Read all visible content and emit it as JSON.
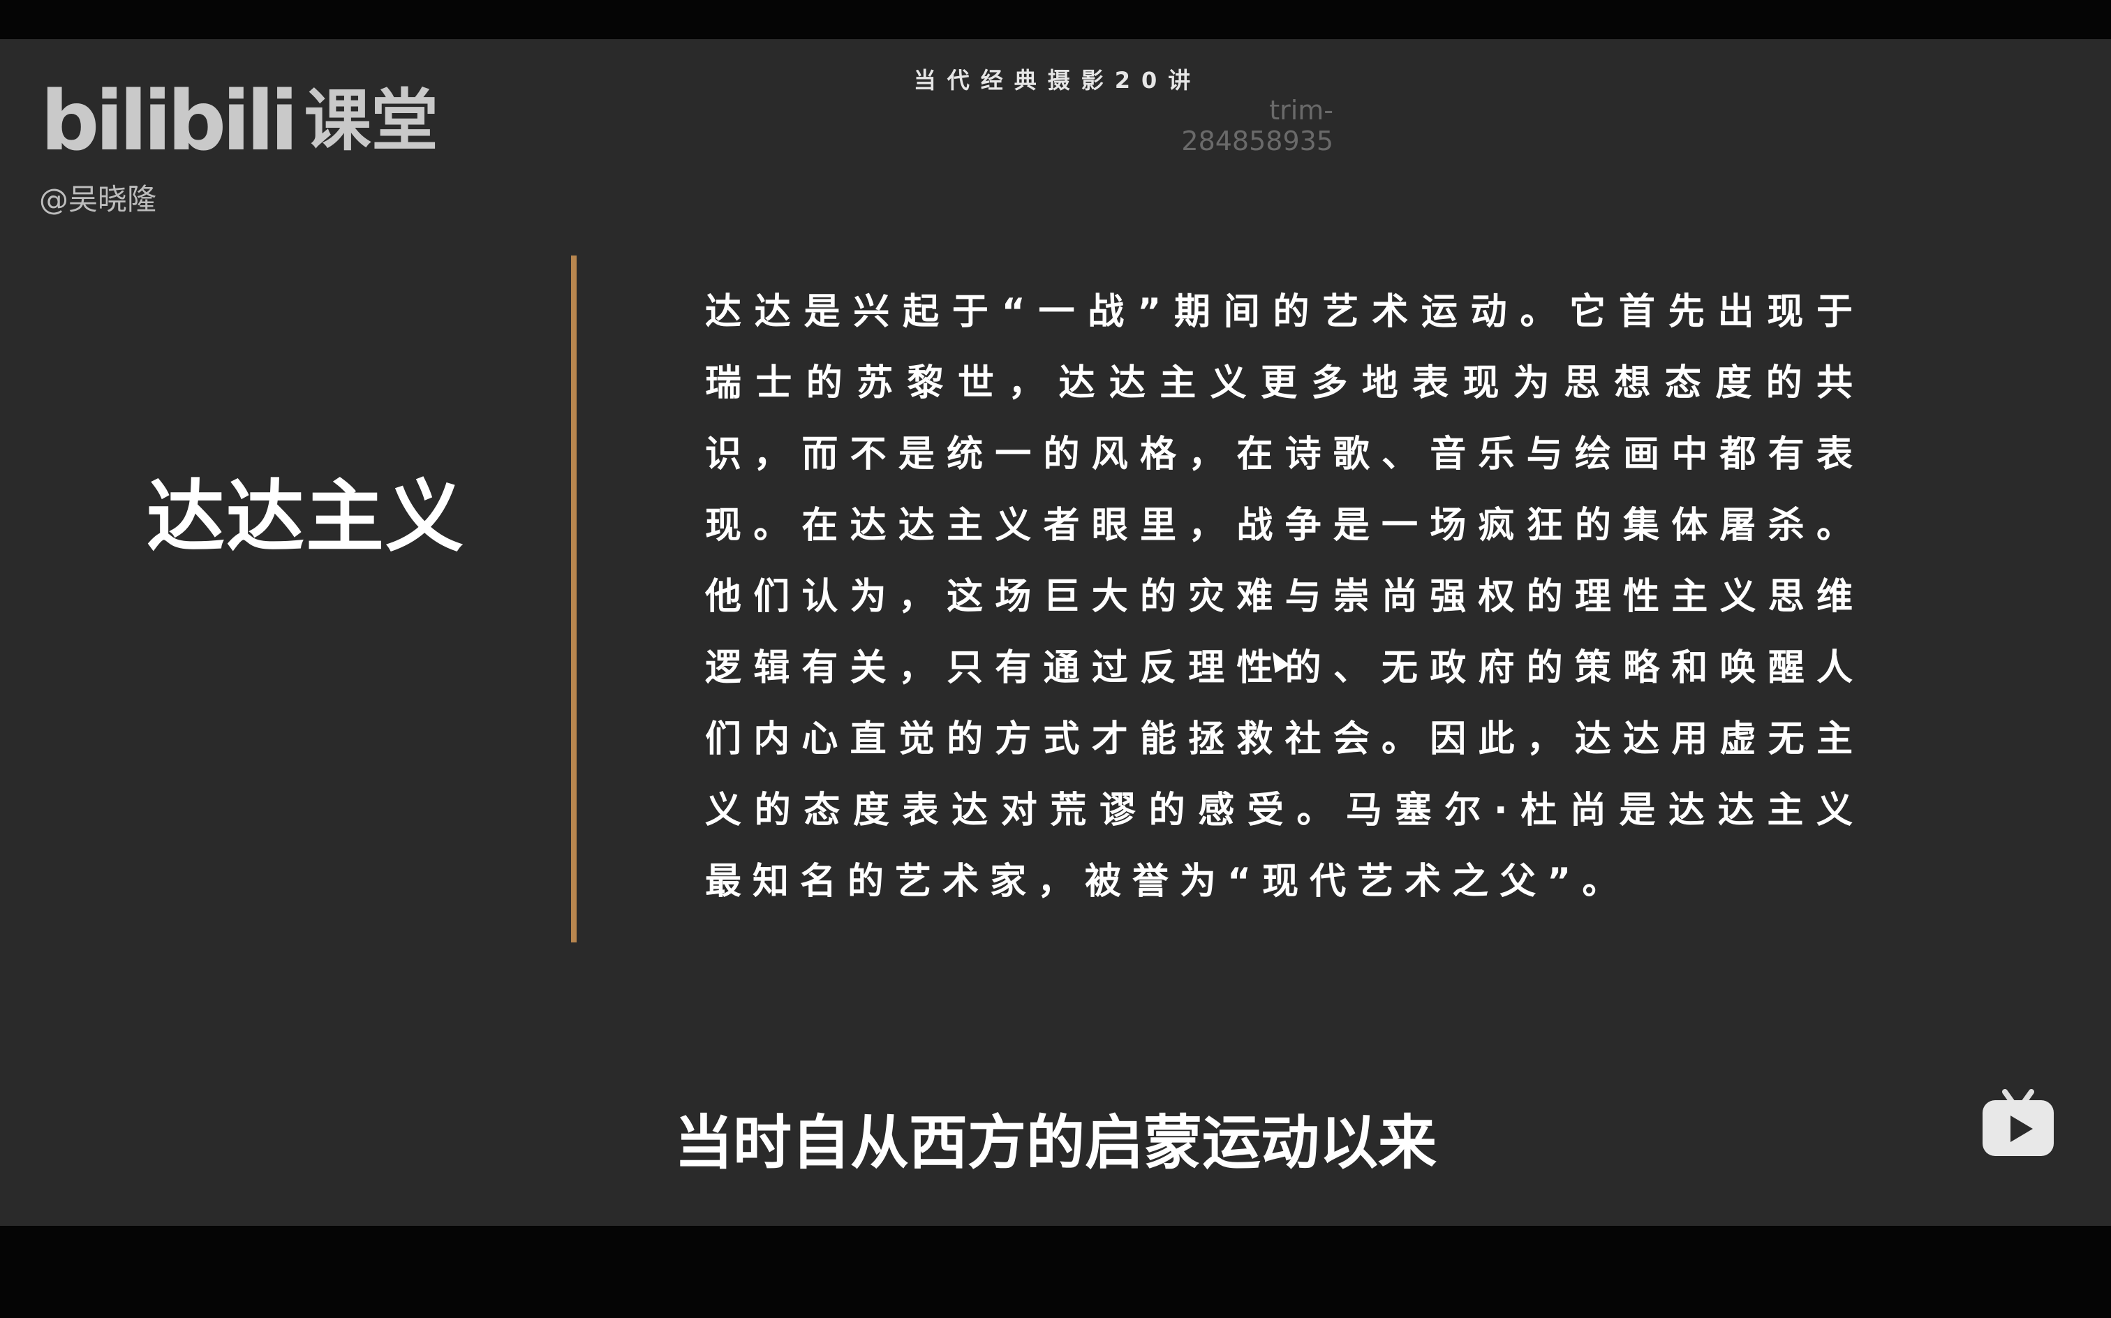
{
  "video": {
    "brand_mark": "bilibili",
    "brand_text": "课堂",
    "uploader": "@吴晓隆",
    "series_title": "当代经典摄影20讲",
    "watermark_line1": "trim-",
    "watermark_line2": "284858935",
    "heading": "达达主义",
    "body": "达达是兴起于“一战”期间的艺术运动。它首先出现于瑞士的苏黎世，达达主义更多地表现为思想态度的共识，而不是统一的风格，在诗歌、音乐与绘画中都有表现。在达达主义者眼里，战争是一场疯狂的集体屠杀。他们认为，这场巨大的灾难与崇尚强权的理性主义思维逻辑有关，只有通过反理性的、无政府的策略和唤醒人们内心直觉的方式才能拯救社会。因此，达达用虚无主义的态度表达对荒谬的感受。马塞尔·杜尚是达达主义最知名的艺术家，被誉为“现代艺术之父”。",
    "subtitle": "当时自从西方的启蒙运动以来"
  },
  "icons": {
    "tv": "bilibili-tv-icon",
    "cursor": "mouse-cursor-icon"
  },
  "colors": {
    "background": "#2a2a2a",
    "divider": "#b8864f",
    "text": "#ffffff",
    "logo": "#c9c9c9"
  }
}
